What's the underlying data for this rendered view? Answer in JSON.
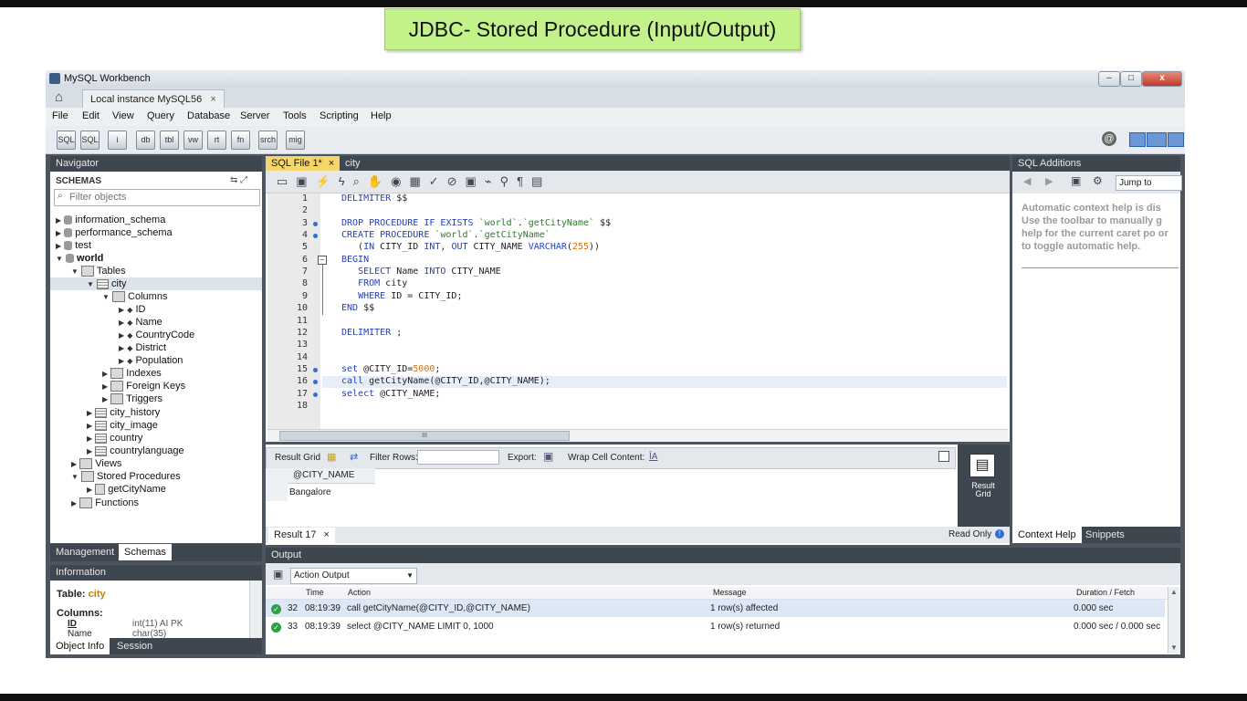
{
  "banner": {
    "title": "JDBC- Stored Procedure (Input/Output)"
  },
  "window": {
    "title": "MySQL Workbench",
    "controls": {
      "minimize": "–",
      "maximize": "□",
      "close": "x"
    },
    "connection_tab": "Local instance MySQL56",
    "close_glyph": "×"
  },
  "menu": [
    "File",
    "Edit",
    "View",
    "Query",
    "Database",
    "Server",
    "Tools",
    "Scripting",
    "Help"
  ],
  "toolbar": {
    "buttons": [
      "SQL",
      "SQL",
      "i",
      "db",
      "tbl",
      "vw",
      "rt",
      "fn",
      "chk",
      "srch",
      "mig"
    ],
    "account_icon": "@"
  },
  "navigator": {
    "header": "Navigator",
    "schemas_label": "SCHEMAS",
    "filter_placeholder": "Filter objects",
    "tree": [
      {
        "label": "information_schema"
      },
      {
        "label": "performance_schema"
      },
      {
        "label": "test"
      },
      {
        "label": "world"
      },
      {
        "label": "Tables"
      },
      {
        "label": "city"
      },
      {
        "label": "Columns"
      },
      {
        "label": "ID"
      },
      {
        "label": "Name"
      },
      {
        "label": "CountryCode"
      },
      {
        "label": "District"
      },
      {
        "label": "Population"
      },
      {
        "label": "Indexes"
      },
      {
        "label": "Foreign Keys"
      },
      {
        "label": "Triggers"
      },
      {
        "label": "city_history"
      },
      {
        "label": "city_image"
      },
      {
        "label": "country"
      },
      {
        "label": "countrylanguage"
      },
      {
        "label": "Views"
      },
      {
        "label": "Stored Procedures"
      },
      {
        "label": "getCityName"
      },
      {
        "label": "Functions"
      }
    ],
    "bottom_tabs": [
      "Management",
      "Schemas"
    ]
  },
  "info_panel": {
    "header": "Information",
    "table_label": "Table:",
    "table_name": "city",
    "columns_label": "Columns:",
    "columns": [
      {
        "name": "ID",
        "type": "int(11) AI PK"
      },
      {
        "name": "Name",
        "type": "char(35)"
      }
    ],
    "bottom_tabs": [
      "Object Info",
      "Session"
    ]
  },
  "editor": {
    "tabs": [
      "SQL File 1*",
      "city"
    ],
    "lines": [
      {
        "n": "1",
        "text": "DELIMITER $$"
      },
      {
        "n": "2",
        "text": ""
      },
      {
        "n": "3",
        "text": "DROP PROCEDURE IF EXISTS `world`.`getCityName` $$"
      },
      {
        "n": "4",
        "text": "CREATE PROCEDURE `world`.`getCityName`"
      },
      {
        "n": "5",
        "text": "   (IN CITY_ID INT, OUT CITY_NAME VARCHAR(255))"
      },
      {
        "n": "6",
        "text": "BEGIN"
      },
      {
        "n": "7",
        "text": "   SELECT Name INTO CITY_NAME"
      },
      {
        "n": "8",
        "text": "   FROM city"
      },
      {
        "n": "9",
        "text": "   WHERE ID = CITY_ID;"
      },
      {
        "n": "10",
        "text": "END $$"
      },
      {
        "n": "11",
        "text": ""
      },
      {
        "n": "12",
        "text": "DELIMITER ;"
      },
      {
        "n": "13",
        "text": ""
      },
      {
        "n": "14",
        "text": ""
      },
      {
        "n": "15",
        "text": "set @CITY_ID=5000;"
      },
      {
        "n": "16",
        "text": "call getCityName(@CITY_ID,@CITY_NAME);"
      },
      {
        "n": "17",
        "text": "select @CITY_NAME;"
      },
      {
        "n": "18",
        "text": ""
      }
    ],
    "scroll_grip": "III"
  },
  "result": {
    "toolbar": {
      "result_grid": "Result Grid",
      "filter_rows": "Filter Rows:",
      "export": "Export:",
      "wrap": "Wrap Cell Content:"
    },
    "column": "@CITY_NAME",
    "value": "Bangalore",
    "side_button": "Result Grid",
    "tab": "Result 17",
    "read_only": "Read Only"
  },
  "sql_additions": {
    "header": "SQL Additions",
    "jump_to": "Jump to",
    "help_text": "Automatic context help is dis Use the toolbar to manually g help for the current caret po or to toggle automatic help.",
    "bottom_tabs": [
      "Context Help",
      "Snippets"
    ]
  },
  "output": {
    "header": "Output",
    "selector": "Action Output",
    "columns": [
      "Time",
      "Action",
      "Message",
      "Duration / Fetch"
    ],
    "rows": [
      {
        "num": "32",
        "time": "08:19:39",
        "action": "call getCityName(@CITY_ID,@CITY_NAME)",
        "message": "1 row(s) affected",
        "duration": "0.000 sec"
      },
      {
        "num": "33",
        "time": "08:19:39",
        "action": "select @CITY_NAME LIMIT 0, 1000",
        "message": "1 row(s) returned",
        "duration": "0.000 sec / 0.000 sec"
      }
    ]
  }
}
